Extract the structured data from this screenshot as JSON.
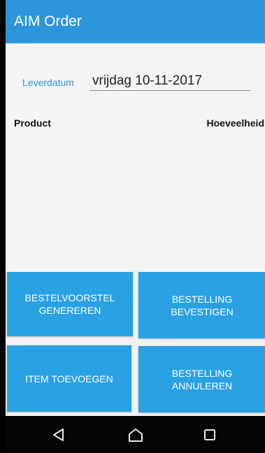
{
  "app_bar": {
    "title": "AIM Order"
  },
  "form": {
    "delivery_label": "Leverdatum",
    "delivery_value": "vrijdag 10-11-2017"
  },
  "table": {
    "col_product": "Product",
    "col_quantity": "Hoeveelheid"
  },
  "buttons": {
    "generate": "BESTELVOORSTEL\nGENEREREN",
    "confirm": "BESTELLING\nBEVESTIGEN",
    "add_item": "ITEM TOEVOEGEN",
    "cancel": "BESTELLING\nANNULEREN"
  },
  "nav": {
    "back_icon": "back-triangle-icon",
    "home_icon": "home-icon",
    "recent_icon": "recent-apps-icon"
  },
  "colors": {
    "primary": "#2d95d9",
    "button": "#2aa1e3",
    "background": "#f4f4f4",
    "nav_bar": "#050505"
  }
}
